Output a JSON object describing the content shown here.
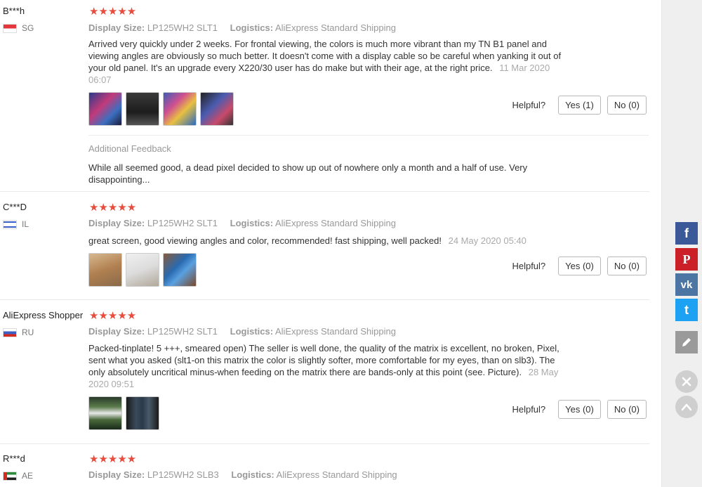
{
  "helpful_label": "Helpful?",
  "reviews": [
    {
      "user": "B***h",
      "country": "SG",
      "stars": "★★★★★",
      "attr1_label": "Display Size:",
      "attr1_value": "LP125WH2 SLT1",
      "attr2_label": "Logistics:",
      "attr2_value": "AliExpress Standard Shipping",
      "text": "Arrived very quickly under 2 weeks. For frontal viewing, the colors is much more vibrant than my TN B1 panel and viewing angles are obviously so much better. It doesn't come with a display cable so be careful when yanking it out of your old panel. It's an upgrade every X220/30 user has do make but with their age, at the right price.",
      "date": "11 Mar 2020 06:07",
      "yes": "Yes (1)",
      "no": "No (0)",
      "feedback_title": "Additional Feedback",
      "feedback_text": "While all seemed good, a dead pixel decided to show up out of nowhere only a month and a half of use. Very disappointing..."
    },
    {
      "user": "C***D",
      "country": "IL",
      "stars": "★★★★★",
      "attr1_label": "Display Size:",
      "attr1_value": "LP125WH2 SLT1",
      "attr2_label": "Logistics:",
      "attr2_value": "AliExpress Standard Shipping",
      "text": "great screen, good viewing angles and color, recommended! fast shipping, well packed!",
      "date": "24 May 2020 05:40",
      "yes": "Yes (0)",
      "no": "No (0)"
    },
    {
      "user": "AliExpress Shopper",
      "country": "RU",
      "stars": "★★★★★",
      "attr1_label": "Display Size:",
      "attr1_value": "LP125WH2 SLT1",
      "attr2_label": "Logistics:",
      "attr2_value": "AliExpress Standard Shipping",
      "text": "Packed-tinplate! 5 +++, smeared open) The seller is well done, the quality of the matrix is excellent, no broken, Pixel, sent what you asked (slt1-on this matrix the color is slightly softer, more comfortable for my eyes, than on slb3). The only absolutely uncritical minus-when feeding on the matrix there are bands-only at this point (see. Picture).",
      "date": "28 May 2020 09:51",
      "yes": "Yes (0)",
      "no": "No (0)"
    },
    {
      "user": "R***d",
      "country": "AE",
      "stars": "★★★★★",
      "attr1_label": "Display Size:",
      "attr1_value": "LP125WH2 SLB3",
      "attr2_label": "Logistics:",
      "attr2_value": "AliExpress Standard Shipping"
    }
  ],
  "share": {
    "facebook": "f",
    "pinterest": "P",
    "vk": "vk",
    "twitter": "t",
    "edit_icon": "pencil-icon",
    "close_icon": "close-icon",
    "top_icon": "chevron-up-icon"
  },
  "colors": {
    "star": "#e84c3d",
    "facebook": "#3b5998",
    "pinterest": "#cb2027",
    "vk": "#4c75a3",
    "twitter": "#1da1f2"
  }
}
